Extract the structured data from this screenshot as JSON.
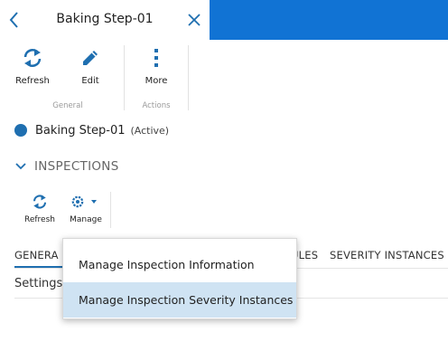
{
  "header": {
    "title": "Baking Step-01",
    "accent_color": "#1173d4"
  },
  "ribbon": {
    "refresh_label": "Refresh",
    "edit_label": "Edit",
    "more_label": "More",
    "group_general": "General",
    "group_actions": "Actions"
  },
  "record": {
    "name": "Baking Step-01",
    "state": "(Active)",
    "status_color": "#1f6fb0"
  },
  "inspections": {
    "section_title": "INSPECTIONS",
    "refresh_label": "Refresh",
    "manage_label": "Manage"
  },
  "tabs": {
    "items": [
      "GENERA",
      "ULES",
      "SEVERITY INSTANCES"
    ],
    "active": "GENERA"
  },
  "settings_title": "Settings",
  "dropdown": {
    "items": [
      "Manage Inspection Information",
      "Manage Inspection Severity Instances"
    ],
    "highlighted": "Manage Inspection Severity Instances"
  }
}
